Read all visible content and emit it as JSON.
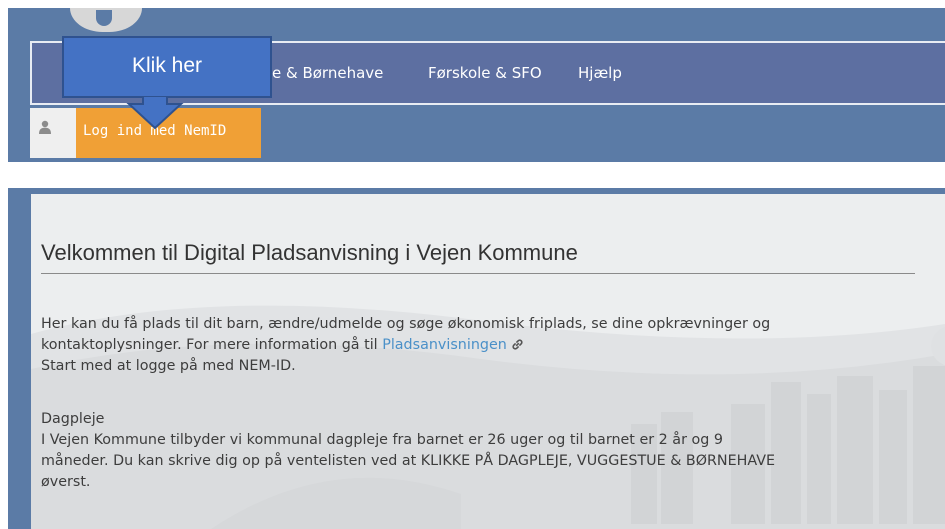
{
  "nav": {
    "items": [
      {
        "label": "e & Børnehave"
      },
      {
        "label": "Førskole & SFO"
      },
      {
        "label": "Hjælp"
      }
    ],
    "login_label": "Log ind med NemID"
  },
  "callout": {
    "text": "Klik her"
  },
  "content": {
    "title": "Velkommen til Digital Pladsanvisning i Vejen Kommune",
    "intro_line1": "Her kan du få plads til dit barn, ændre/udmelde og søge økonomisk friplads, se dine opkrævninger og",
    "intro_line2_prefix": "kontaktoplysninger. For mere information gå til ",
    "intro_link": "Pladsanvisningen",
    "intro_line3": "Start med at logge på med NEM-ID.",
    "section_heading": "Dagpleje",
    "section_line1": "I Vejen Kommune tilbyder vi kommunal dagpleje fra barnet er 26 uger og til barnet er 2 år og 9",
    "section_line2": "måneder. Du kan skrive dig op på ventelisten ved at KLIKKE PÅ DAGPLEJE, VUGGESTUE & BØRNEHAVE",
    "section_line3": "øverst."
  },
  "colors": {
    "header": "#5b7ba6",
    "menu": "#5d6fa1",
    "login_button": "#f0a036",
    "callout": "#4472c4",
    "link": "#4a90c8"
  },
  "icons": [
    "user-icon",
    "external-link-icon"
  ]
}
